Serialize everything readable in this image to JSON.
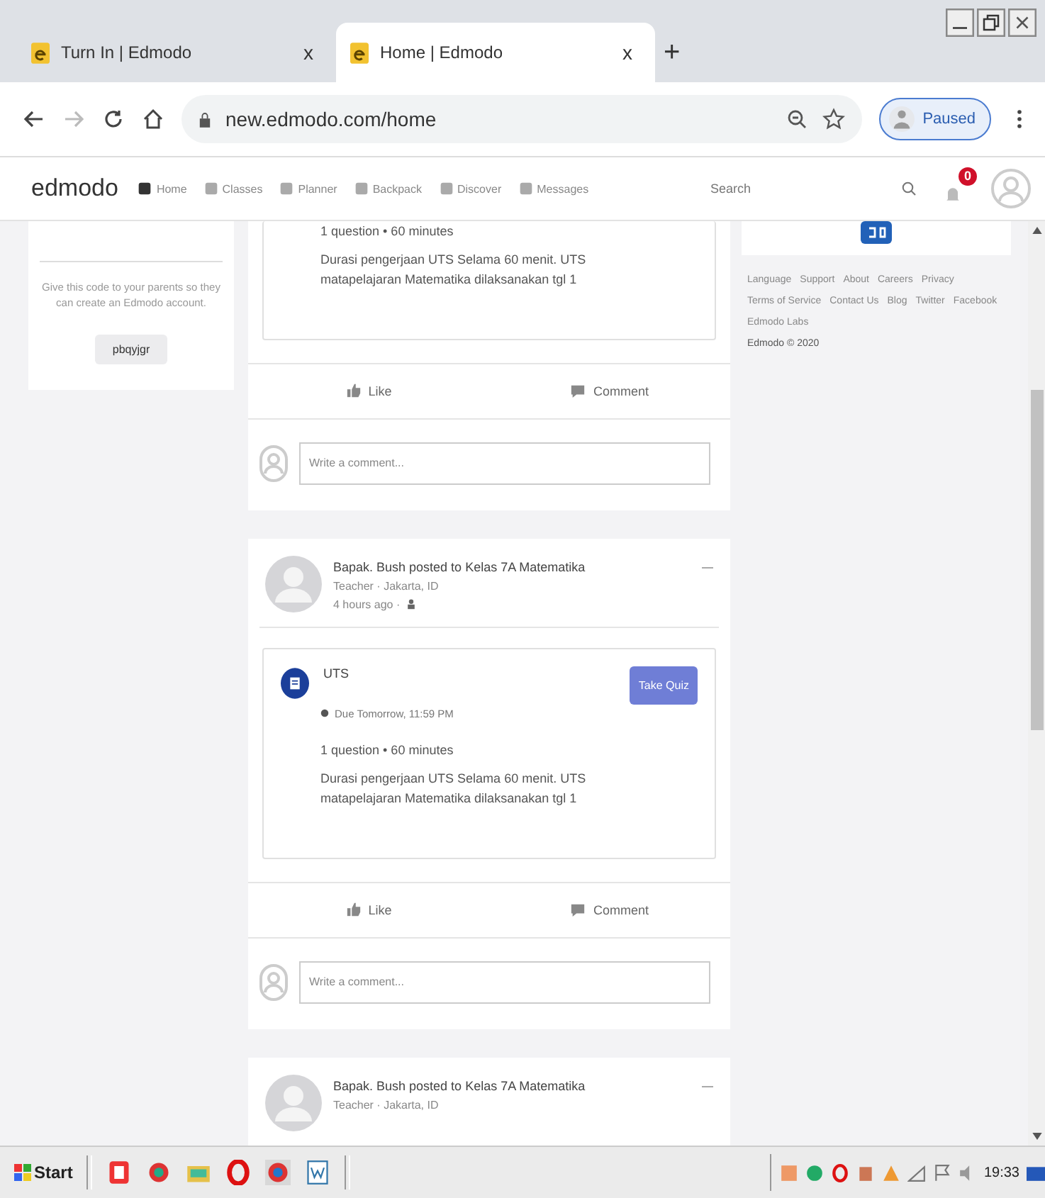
{
  "browser": {
    "tabs": [
      {
        "title": "Turn In | Edmodo",
        "close": "x",
        "selected": false
      },
      {
        "title": "Home | Edmodo",
        "close": "x",
        "selected": true
      }
    ],
    "new_tab": "+",
    "url": "new.edmodo.com/home",
    "profile": "Paused"
  },
  "nav": {
    "logo": "edmodo",
    "items": [
      "Home",
      "Classes",
      "Planner",
      "Backpack",
      "Discover",
      "Messages"
    ],
    "search_placeholder": "Search",
    "notification_count": "0"
  },
  "left_panel": {
    "text": "Give this code to your parents so they can create an Edmodo account.",
    "code": "pbqyjgr"
  },
  "posts": [
    {
      "kind": "quiz_tail",
      "quiz_meta": "1 question • 60 minutes",
      "description": "Durasi pengerjaan UTS Selama 60 menit. UTS matapelajaran Matematika dilaksanakan tgl 1",
      "like": "Like",
      "comment": "Comment",
      "comment_placeholder": "Write a comment..."
    },
    {
      "kind": "full",
      "author": "Bapak. Bush posted to Kelas 7A Matematika",
      "role": "Teacher · Jakarta, ID",
      "time": "4 hours ago ·",
      "quiz_title": "UTS",
      "quiz_button": "Take Quiz",
      "due": "Due Tomorrow, 11:59 PM",
      "quiz_meta": "1 question • 60 minutes",
      "description": "Durasi pengerjaan UTS Selama 60 menit. UTS matapelajaran Matematika dilaksanakan tgl 1",
      "like": "Like",
      "comment": "Comment",
      "comment_placeholder": "Write a comment..."
    },
    {
      "kind": "header_only",
      "author": "Bapak. Bush posted to Kelas 7A Matematika",
      "role": "Teacher · Jakarta, ID"
    }
  ],
  "right_panel": {
    "footer_links": [
      [
        "Language",
        "Support",
        "About",
        "Careers",
        "Privacy"
      ],
      [
        "Terms of Service",
        "Contact Us",
        "Blog",
        "Twitter",
        "Facebook"
      ],
      [
        "Edmodo Labs"
      ]
    ],
    "copyright": "Edmodo © 2020"
  },
  "taskbar": {
    "start": "Start",
    "clock": "19:33"
  }
}
